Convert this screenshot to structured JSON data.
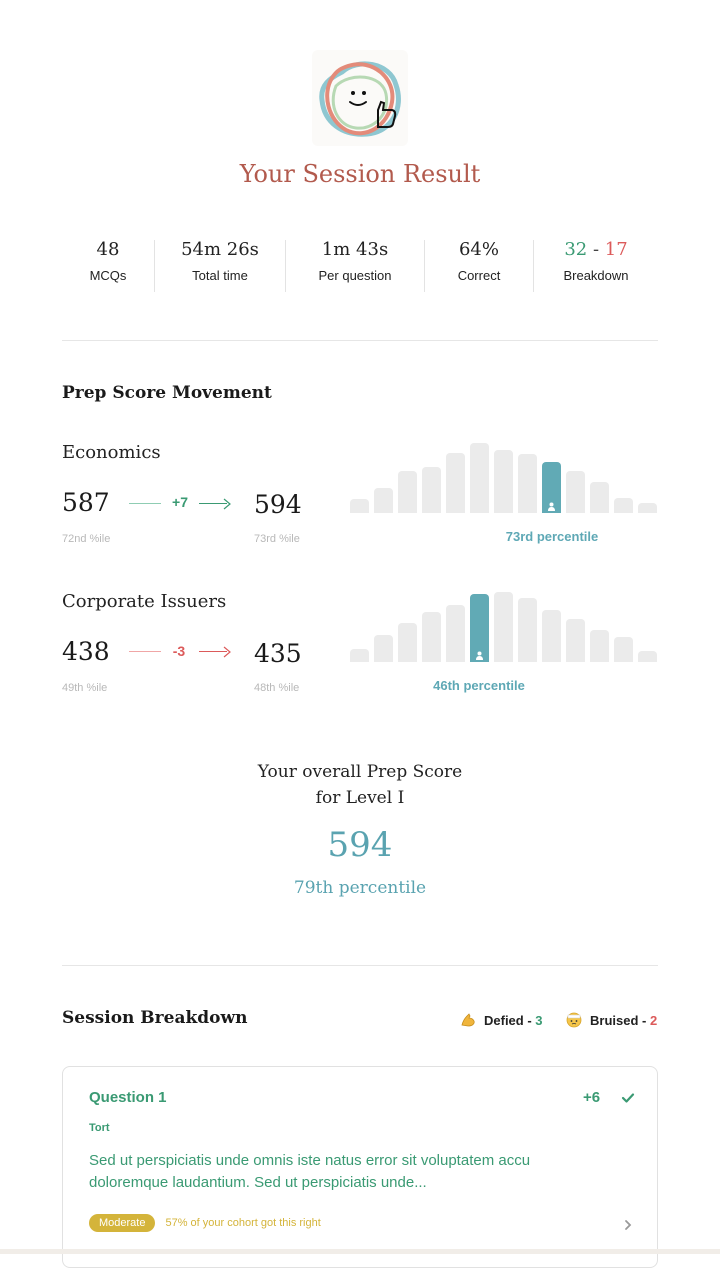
{
  "header": {
    "title": "Your Session Result",
    "logo_icon": "smiley-thumbs-up-icon"
  },
  "stats": [
    {
      "value": "48",
      "label": "MCQs"
    },
    {
      "value": "54m 26s",
      "label": "Total time"
    },
    {
      "value": "1m 43s",
      "label": "Per question"
    },
    {
      "value": "64%",
      "label": "Correct"
    },
    {
      "value_correct": "32",
      "separator": "-",
      "value_incorrect": "17",
      "label": "Breakdown"
    }
  ],
  "prep_movement": {
    "title": "Prep Score Movement",
    "subjects": [
      {
        "name": "Economics",
        "from_score": "587",
        "from_pctile": "72nd %ile",
        "delta": "+7",
        "to_score": "594",
        "to_pctile": "73rd %ile",
        "percentile_label": "73rd percentile",
        "distribution": [
          0.2,
          0.36,
          0.6,
          0.66,
          0.86,
          1.0,
          0.9,
          0.84,
          0.73,
          0.6,
          0.44,
          0.21,
          0.14
        ],
        "active_index": 8
      },
      {
        "name": "Corporate Issuers",
        "from_score": "438",
        "from_pctile": "49th %ile",
        "delta": "-3",
        "to_score": "435",
        "to_pctile": "48th %ile",
        "percentile_label": "46th percentile",
        "distribution": [
          0.19,
          0.39,
          0.55,
          0.72,
          0.81,
          0.97,
          1.0,
          0.92,
          0.74,
          0.61,
          0.46,
          0.35,
          0.15
        ],
        "active_index": 5
      }
    ]
  },
  "overall": {
    "caption_line1": "Your overall Prep Score",
    "caption_line2": "for Level I",
    "score": "594",
    "percentile": "79th percentile"
  },
  "breakdown": {
    "title": "Session Breakdown",
    "defied_label": "Defied -",
    "defied_count": "3",
    "defied_icon": "flexed-biceps-icon",
    "bruised_label": "Bruised -",
    "bruised_count": "2",
    "bruised_icon": "bandaged-face-icon"
  },
  "question_card": {
    "title": "Question 1",
    "category": "Tort",
    "text": "Sed ut perspiciatis unde omnis iste natus error sit voluptatem accu doloremque laudantium. Sed ut perspiciatis unde...",
    "gain": "+6",
    "difficulty": "Moderate",
    "cohort_text": "57% of your cohort got this right"
  },
  "colors": {
    "accent_teal": "#5aa3b0",
    "green": "#3a9a73",
    "red": "#dc5a5a",
    "gold": "#c9a531",
    "title_red": "#b25a4d"
  }
}
